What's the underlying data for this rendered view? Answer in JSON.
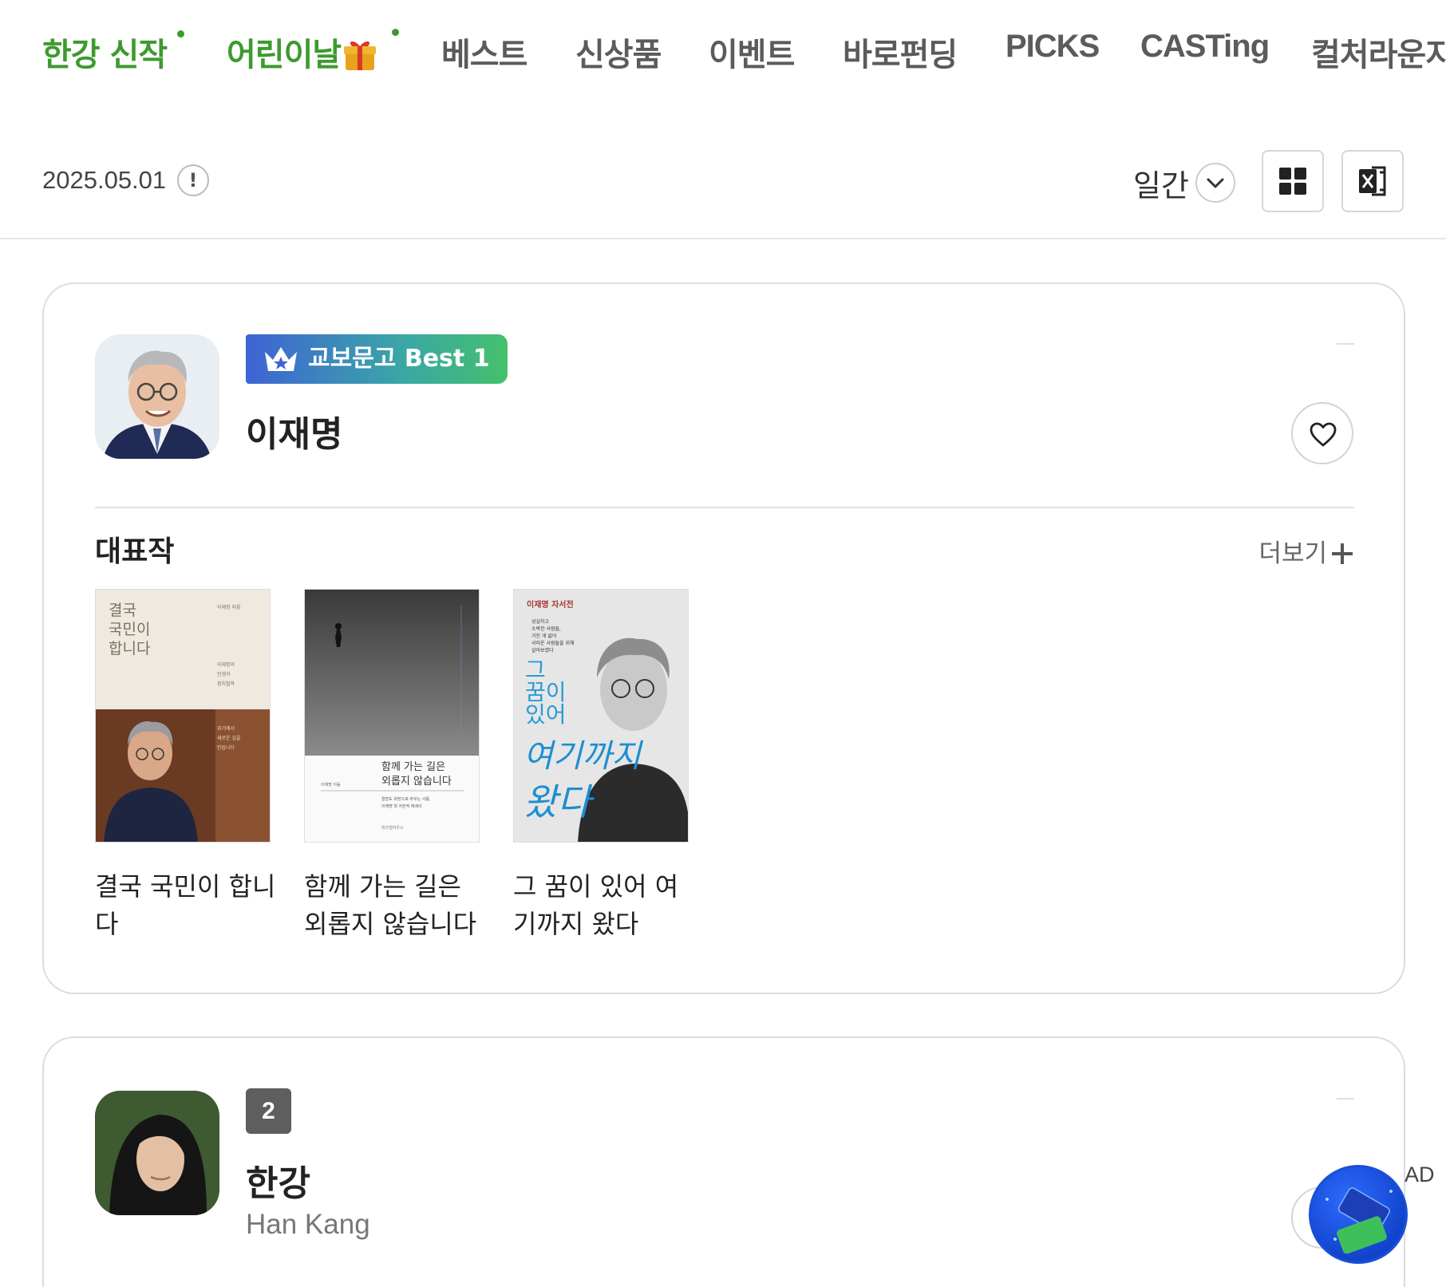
{
  "nav": {
    "items": [
      {
        "label": "한강 신작",
        "highlight": true,
        "dot": true
      },
      {
        "label": "어린이날",
        "highlight": true,
        "dot": true,
        "icon": "gift-icon"
      },
      {
        "label": "베스트",
        "highlight": false
      },
      {
        "label": "신상품",
        "highlight": false
      },
      {
        "label": "이벤트",
        "highlight": false
      },
      {
        "label": "바로펀딩",
        "highlight": false
      },
      {
        "label": "PICKS",
        "highlight": false
      },
      {
        "label": "CASTing",
        "highlight": false
      },
      {
        "label": "컬처라운지",
        "highlight": false
      }
    ]
  },
  "toolbar": {
    "date": "2025.05.01",
    "info_icon": "!",
    "period": "일간",
    "view_icon": "grid-icon",
    "export_icon": "excel-icon"
  },
  "cards": [
    {
      "badge": "교보문고 Best 1",
      "name": "이재명",
      "section_title": "대표작",
      "more_label": "더보기",
      "books": [
        {
          "title": "결국 국민이 합니다",
          "cover": {
            "title_lines": [
              "결국",
              "국민이",
              "합니다"
            ],
            "author_small": "이재명 지음",
            "sub_lines": [
              "이재명의",
              "인생과",
              "정치철학"
            ],
            "quote_lines": [
              "위기에서",
              "새로운 길을",
              "만듭니다"
            ]
          }
        },
        {
          "title": "함께 가는 길은 외롭지 않습니다",
          "cover": {
            "title_lines": [
              "함께 가는 길은",
              "외롭지 않습니다"
            ],
            "author_small": "이재명 지음",
            "blurb_lines": [
              "절망도 희망으로 바꾸는 사람,",
              "이재명 첫 자전적 에세이"
            ],
            "publisher": "위즈덤하우스"
          }
        },
        {
          "title": "그 꿈이 있어 여기까지 왔다",
          "cover": {
            "series": "이재명 자서전",
            "intro_lines": [
              "성실하고",
              "소박한 사람들,",
              "가진 게 없어",
              "서러운 사람들을 위해",
              "살아보겠다"
            ],
            "title_small": [
              "그",
              "꿈이",
              "있어"
            ],
            "title_big": [
              "여기까지",
              "왔다"
            ]
          }
        }
      ]
    },
    {
      "rank": "2",
      "name": "한강",
      "name_en": "Han Kang"
    }
  ],
  "ad": {
    "label": "AD"
  }
}
